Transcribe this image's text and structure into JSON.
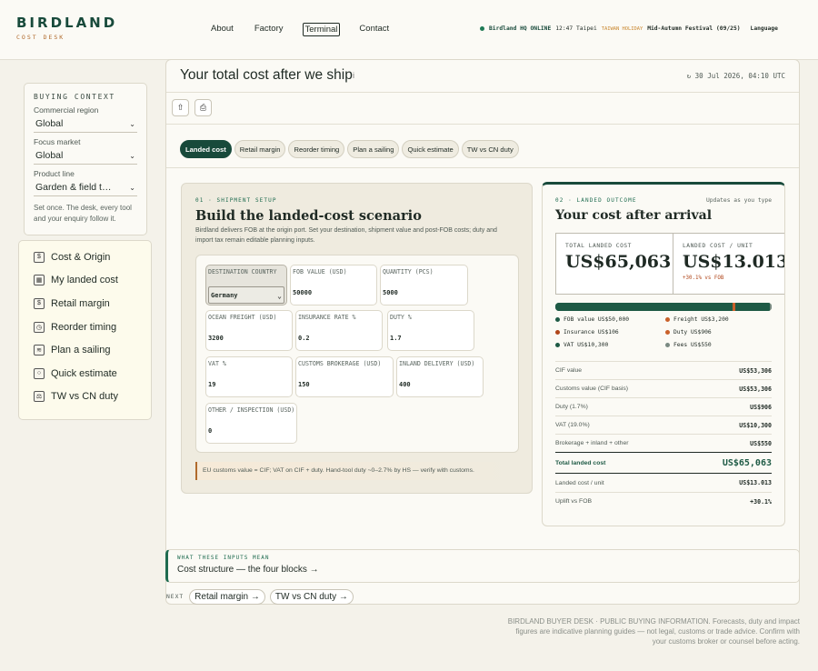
{
  "brand": {
    "name": "BIRDLAND",
    "sub": "COST DESK"
  },
  "nav": [
    "About",
    "Factory",
    "Terminal",
    "Contact"
  ],
  "status": {
    "hq": "Birdland HQ ONLINE",
    "time": "12:47 Taipei",
    "holiday_tag": "TAIWAN HOLIDAY",
    "festival": "Mid-Autumn Festival (09/25)",
    "language": "Language"
  },
  "context": {
    "title": "BUYING CONTEXT",
    "region_label": "Commercial region",
    "region_value": "Global",
    "market_label": "Focus market",
    "market_value": "Global",
    "product_label": "Product line",
    "product_value": "Garden & field t…",
    "note": "Set once. The desk, every tool and your enquiry follow it."
  },
  "sidenav": [
    {
      "label": "Cost & Origin",
      "icon": "coin-icon",
      "glyph": "$"
    },
    {
      "label": "My landed cost",
      "icon": "box-icon",
      "glyph": "▦"
    },
    {
      "label": "Retail margin",
      "icon": "dollar-icon",
      "glyph": "$"
    },
    {
      "label": "Reorder timing",
      "icon": "clock-icon",
      "glyph": "◷"
    },
    {
      "label": "Plan a sailing",
      "icon": "wave-icon",
      "glyph": "≋"
    },
    {
      "label": "Quick estimate",
      "icon": "circle-icon",
      "glyph": "○"
    },
    {
      "label": "TW vs CN duty",
      "icon": "scale-icon",
      "glyph": "⚖"
    }
  ],
  "main": {
    "title": "Your total cost after we ship",
    "info": "i",
    "timestamp": "30 Jul 2026, 04:10 UTC",
    "tabs": [
      "Landed cost",
      "Retail margin",
      "Reorder timing",
      "Plan a sailing",
      "Quick estimate",
      "TW vs CN duty"
    ]
  },
  "scenario": {
    "kicker": "01 · SHIPMENT SETUP",
    "title": "Build the landed-cost scenario",
    "desc": "Birdland delivers FOB at the origin port. Set your destination, shipment value and post-FOB costs; duty and import tax remain editable planning inputs.",
    "fields": {
      "destination": {
        "label": "DESTINATION COUNTRY",
        "value": "Germany"
      },
      "fob": {
        "label": "FOB VALUE (USD)",
        "value": "50000"
      },
      "qty": {
        "label": "QUANTITY (PCS)",
        "value": "5000"
      },
      "freight": {
        "label": "OCEAN FREIGHT (USD)",
        "value": "3200"
      },
      "insurance": {
        "label": "INSURANCE RATE %",
        "value": "0.2"
      },
      "duty": {
        "label": "DUTY %",
        "value": "1.7"
      },
      "vat": {
        "label": "VAT %",
        "value": "19"
      },
      "brokerage": {
        "label": "CUSTOMS BROKERAGE (USD)",
        "value": "150"
      },
      "inland": {
        "label": "INLAND DELIVERY (USD)",
        "value": "400"
      },
      "other": {
        "label": "OTHER / INSPECTION (USD)",
        "value": "0"
      }
    },
    "note": "EU customs value = CIF; VAT on CIF + duty. Hand-tool duty ~0–2.7% by HS — verify with customs."
  },
  "outcome": {
    "kicker": "02 · LANDED OUTCOME",
    "updates": "Updates as you type",
    "title": "Your cost after arrival",
    "total_label": "TOTAL LANDED COST",
    "total_value": "US$65,063",
    "unit_label": "LANDED COST / UNIT",
    "unit_value": "US$13.013",
    "unit_sub": "+30.1% vs FOB",
    "bar": [
      {
        "value": 50000,
        "color": "#1e5a45"
      },
      {
        "value": 3200,
        "color": "#1e5a45"
      },
      {
        "value": 106,
        "color": "#b0461a"
      },
      {
        "value": 906,
        "color": "#c9602a"
      },
      {
        "value": 10300,
        "color": "#1e5a45"
      },
      {
        "value": 550,
        "color": "#7a8a82"
      }
    ],
    "legend": [
      {
        "label": "FOB value US$50,000",
        "color": "#1e5a45"
      },
      {
        "label": "Freight US$3,200",
        "color": "#c9602a"
      },
      {
        "label": "Insurance US$106",
        "color": "#b0461a"
      },
      {
        "label": "Duty US$906",
        "color": "#c9602a"
      },
      {
        "label": "VAT US$10,300",
        "color": "#1e5a45"
      },
      {
        "label": "Fees US$550",
        "color": "#7a8a82"
      }
    ],
    "rows": [
      {
        "label": "CIF value",
        "value": "US$53,306"
      },
      {
        "label": "Customs value (CIF basis)",
        "value": "US$53,306"
      },
      {
        "label": "Duty (1.7%)",
        "value": "US$906"
      },
      {
        "label": "VAT (19.0%)",
        "value": "US$10,300"
      },
      {
        "label": "Brokerage + inland + other",
        "value": "US$550"
      }
    ],
    "total_row": {
      "label": "Total landed cost",
      "value": "US$65,063"
    },
    "rows_after": [
      {
        "label": "Landed cost / unit",
        "value": "US$13.013"
      },
      {
        "label": "Uplift vs FOB",
        "value": "+30.1%"
      }
    ]
  },
  "explain": {
    "kicker": "WHAT THESE INPUTS MEAN",
    "link": "Cost structure — the four blocks →"
  },
  "next": {
    "label": "NEXT",
    "links": [
      "Retail margin →",
      "TW vs CN duty →"
    ]
  },
  "disclaimer": "BIRDLAND BUYER DESK · PUBLIC BUYING INFORMATION. Forecasts, duty and impact figures are indicative planning guides — not legal, customs or trade advice. Confirm with your customs broker or counsel before acting."
}
